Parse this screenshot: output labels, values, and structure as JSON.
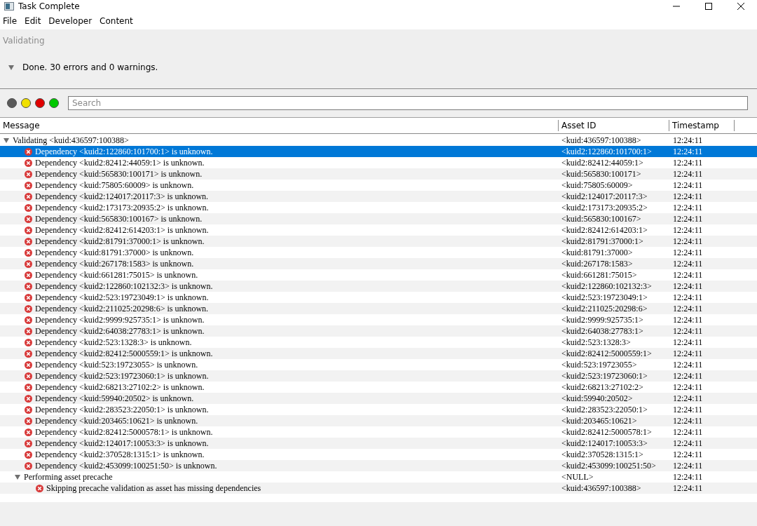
{
  "window": {
    "title": "Task Complete"
  },
  "menu": [
    "File",
    "Edit",
    "Developer",
    "Content"
  ],
  "status": {
    "label": "Validating",
    "summary": "Done. 30 errors and 0 warnings.",
    "expanded": true
  },
  "filters": [
    {
      "color": "#5a5a5a"
    },
    {
      "color": "#f0e000"
    },
    {
      "color": "#e00000"
    },
    {
      "color": "#00c800"
    }
  ],
  "search": {
    "placeholder": "Search"
  },
  "table": {
    "columns": [
      "Message",
      "Asset ID",
      "Timestamp"
    ],
    "rows": [
      {
        "kind": "group",
        "message": "Validating <kuid:436597:100388>",
        "asset_id": "<kuid:436597:100388>",
        "timestamp": "12:24:11",
        "selected": false,
        "expanded": true,
        "children": [
          {
            "kind": "error",
            "message": "Dependency <kuid2:122860:101700:1> is unknown.",
            "asset_id": "<kuid2:122860:101700:1>",
            "timestamp": "12:24:11",
            "selected": true
          },
          {
            "kind": "error",
            "message": "Dependency <kuid2:82412:44059:1> is unknown.",
            "asset_id": "<kuid2:82412:44059:1>",
            "timestamp": "12:24:11",
            "selected": false
          },
          {
            "kind": "error",
            "message": "Dependency <kuid:565830:100171> is unknown.",
            "asset_id": "<kuid:565830:100171>",
            "timestamp": "12:24:11",
            "selected": false
          },
          {
            "kind": "error",
            "message": "Dependency <kuid:75805:60009> is unknown.",
            "asset_id": "<kuid:75805:60009>",
            "timestamp": "12:24:11",
            "selected": false
          },
          {
            "kind": "error",
            "message": "Dependency <kuid2:124017:20117:3> is unknown.",
            "asset_id": "<kuid2:124017:20117:3>",
            "timestamp": "12:24:11",
            "selected": false
          },
          {
            "kind": "error",
            "message": "Dependency <kuid2:173173:20935:2> is unknown.",
            "asset_id": "<kuid2:173173:20935:2>",
            "timestamp": "12:24:11",
            "selected": false
          },
          {
            "kind": "error",
            "message": "Dependency <kuid:565830:100167> is unknown.",
            "asset_id": "<kuid:565830:100167>",
            "timestamp": "12:24:11",
            "selected": false
          },
          {
            "kind": "error",
            "message": "Dependency <kuid2:82412:614203:1> is unknown.",
            "asset_id": "<kuid2:82412:614203:1>",
            "timestamp": "12:24:11",
            "selected": false
          },
          {
            "kind": "error",
            "message": "Dependency <kuid2:81791:37000:1> is unknown.",
            "asset_id": "<kuid2:81791:37000:1>",
            "timestamp": "12:24:11",
            "selected": false
          },
          {
            "kind": "error",
            "message": "Dependency <kuid:81791:37000> is unknown.",
            "asset_id": "<kuid:81791:37000>",
            "timestamp": "12:24:11",
            "selected": false
          },
          {
            "kind": "error",
            "message": "Dependency <kuid:267178:1583> is unknown.",
            "asset_id": "<kuid:267178:1583>",
            "timestamp": "12:24:11",
            "selected": false
          },
          {
            "kind": "error",
            "message": "Dependency <kuid:661281:75015> is unknown.",
            "asset_id": "<kuid:661281:75015>",
            "timestamp": "12:24:11",
            "selected": false
          },
          {
            "kind": "error",
            "message": "Dependency <kuid2:122860:102132:3> is unknown.",
            "asset_id": "<kuid2:122860:102132:3>",
            "timestamp": "12:24:11",
            "selected": false
          },
          {
            "kind": "error",
            "message": "Dependency <kuid2:523:19723049:1> is unknown.",
            "asset_id": "<kuid2:523:19723049:1>",
            "timestamp": "12:24:11",
            "selected": false
          },
          {
            "kind": "error",
            "message": "Dependency <kuid2:211025:20298:6> is unknown.",
            "asset_id": "<kuid2:211025:20298:6>",
            "timestamp": "12:24:11",
            "selected": false
          },
          {
            "kind": "error",
            "message": "Dependency <kuid2:9999:925735:1> is unknown.",
            "asset_id": "<kuid2:9999:925735:1>",
            "timestamp": "12:24:11",
            "selected": false
          },
          {
            "kind": "error",
            "message": "Dependency <kuid2:64038:27783:1> is unknown.",
            "asset_id": "<kuid2:64038:27783:1>",
            "timestamp": "12:24:11",
            "selected": false
          },
          {
            "kind": "error",
            "message": "Dependency <kuid2:523:1328:3> is unknown.",
            "asset_id": "<kuid2:523:1328:3>",
            "timestamp": "12:24:11",
            "selected": false
          },
          {
            "kind": "error",
            "message": "Dependency <kuid2:82412:5000559:1> is unknown.",
            "asset_id": "<kuid2:82412:5000559:1>",
            "timestamp": "12:24:11",
            "selected": false
          },
          {
            "kind": "error",
            "message": "Dependency <kuid:523:19723055> is unknown.",
            "asset_id": "<kuid:523:19723055>",
            "timestamp": "12:24:11",
            "selected": false
          },
          {
            "kind": "error",
            "message": "Dependency <kuid2:523:19723060:1> is unknown.",
            "asset_id": "<kuid2:523:19723060:1>",
            "timestamp": "12:24:11",
            "selected": false
          },
          {
            "kind": "error",
            "message": "Dependency <kuid2:68213:27102:2> is unknown.",
            "asset_id": "<kuid2:68213:27102:2>",
            "timestamp": "12:24:11",
            "selected": false
          },
          {
            "kind": "error",
            "message": "Dependency <kuid:59940:20502> is unknown.",
            "asset_id": "<kuid:59940:20502>",
            "timestamp": "12:24:11",
            "selected": false
          },
          {
            "kind": "error",
            "message": "Dependency <kuid2:283523:22050:1> is unknown.",
            "asset_id": "<kuid2:283523:22050:1>",
            "timestamp": "12:24:11",
            "selected": false
          },
          {
            "kind": "error",
            "message": "Dependency <kuid:203465:10621> is unknown.",
            "asset_id": "<kuid:203465:10621>",
            "timestamp": "12:24:11",
            "selected": false
          },
          {
            "kind": "error",
            "message": "Dependency <kuid2:82412:5000578:1> is unknown.",
            "asset_id": "<kuid2:82412:5000578:1>",
            "timestamp": "12:24:11",
            "selected": false
          },
          {
            "kind": "error",
            "message": "Dependency <kuid2:124017:10053:3> is unknown.",
            "asset_id": "<kuid2:124017:10053:3>",
            "timestamp": "12:24:11",
            "selected": false
          },
          {
            "kind": "error",
            "message": "Dependency <kuid2:370528:1315:1> is unknown.",
            "asset_id": "<kuid2:370528:1315:1>",
            "timestamp": "12:24:11",
            "selected": false
          },
          {
            "kind": "error",
            "message": "Dependency <kuid2:453099:100251:50> is unknown.",
            "asset_id": "<kuid2:453099:100251:50>",
            "timestamp": "12:24:11",
            "selected": false
          },
          {
            "kind": "group",
            "message": "Performing asset precache",
            "asset_id": "<NULL>",
            "timestamp": "12:24:11",
            "selected": false,
            "expanded": true,
            "children": [
              {
                "kind": "error",
                "message": "Skipping precache validation as asset has missing dependencies",
                "asset_id": "<kuid:436597:100388>",
                "timestamp": "12:24:11",
                "selected": false
              }
            ]
          }
        ]
      }
    ]
  }
}
